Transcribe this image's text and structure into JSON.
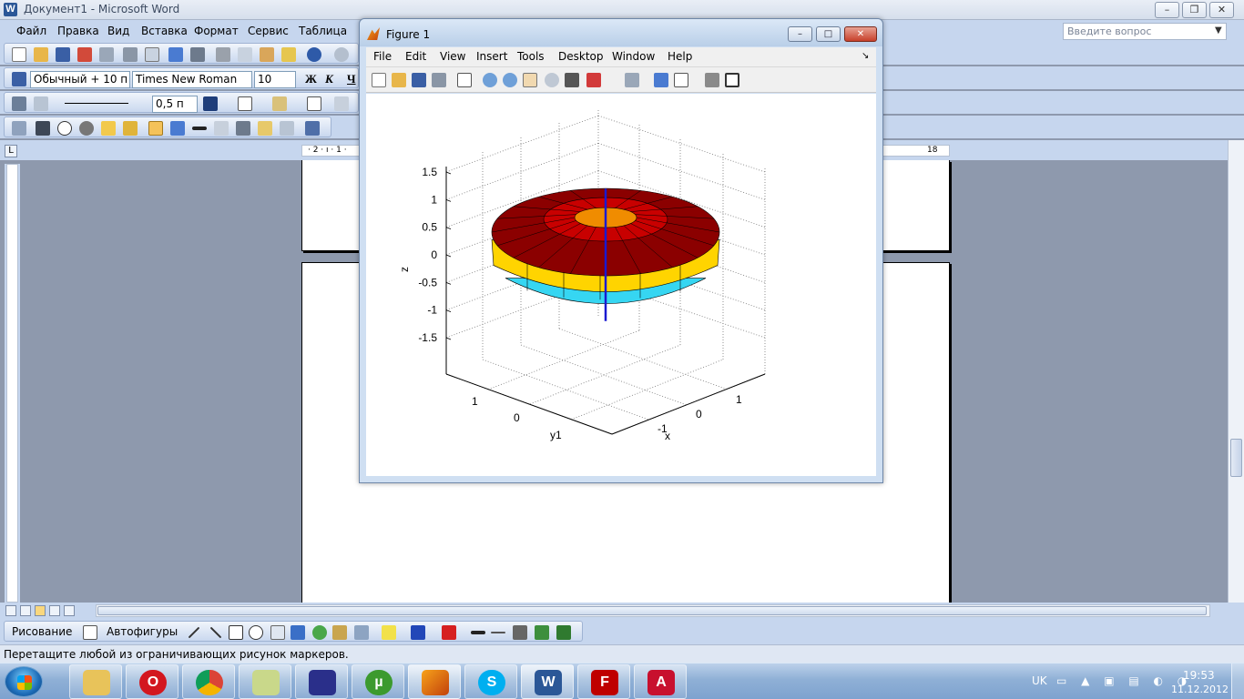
{
  "word": {
    "title": "Документ1 - Microsoft Word",
    "menu": [
      "Файл",
      "Правка",
      "Вид",
      "Вставка",
      "Формат",
      "Сервис",
      "Таблица"
    ],
    "ask_placeholder": "Введите вопрос",
    "format_bar": {
      "style": "Обычный + 10 п",
      "font": "Times New Roman",
      "size": "10",
      "bold": "Ж",
      "italic": "К",
      "underline": "Ч"
    },
    "line_weight": "0,5 п",
    "ruler_left_label": "· 2 · ı · 1 ·",
    "ruler_right_label": "18",
    "drawing_label": "Рисование",
    "autoshapes_label": "Автофигуры",
    "status_text": "Перетащите любой из ограничивающих рисунок маркеров."
  },
  "figure": {
    "title": "Figure 1",
    "menu": [
      "File",
      "Edit",
      "View",
      "Insert",
      "Tools",
      "Desktop",
      "Window",
      "Help"
    ],
    "colors": {
      "top_ring": "#c80000",
      "top_ring_dark": "#8b0000",
      "inner_hole": "#f08c00",
      "side": "#ffd400",
      "bottom": "#36d6f2",
      "axis_line": "#1a1ad0"
    }
  },
  "chart_data": {
    "type": "surface3d",
    "title": "",
    "xlabel": "x",
    "ylabel": "y",
    "zlabel": "z",
    "z_ticks": [
      "1.5",
      "1",
      "0.5",
      "0",
      "-0.5",
      "-1",
      "-1.5"
    ],
    "x_ticks": [
      "-1",
      "0",
      "1"
    ],
    "y_ticks": [
      "1",
      "0",
      "y1"
    ],
    "zlim": [
      -1.5,
      1.5
    ],
    "grid": true,
    "shape": "torus-like surface of revolution with vertical z-axis segment"
  },
  "taskbar": {
    "language": "UK",
    "time": "19:53",
    "date": "11.12.2012",
    "apps": [
      "explorer",
      "opera",
      "chrome",
      "folder",
      "save",
      "utorrent",
      "matlab",
      "skype",
      "word",
      "filezilla",
      "acrobat"
    ]
  }
}
